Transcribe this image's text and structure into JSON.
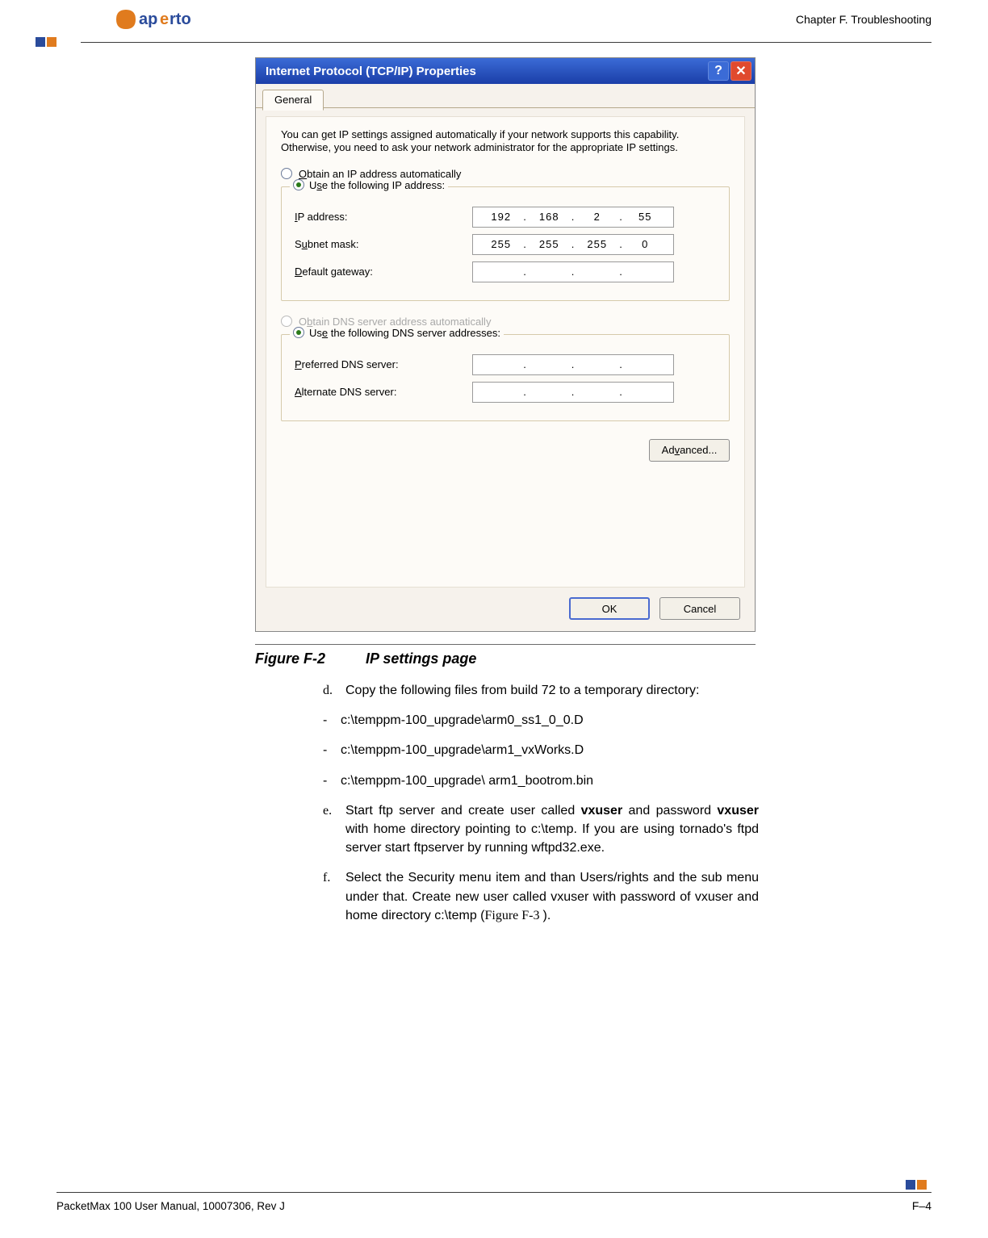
{
  "header": {
    "logo_a": "ap",
    "logo_b": "e",
    "logo_c": "rto",
    "chapter": "Chapter F.  Troubleshooting"
  },
  "dialog": {
    "title": "Internet Protocol (TCP/IP) Properties",
    "tab_general": "General",
    "intro": "You can get IP settings assigned automatically if your network supports this capability. Otherwise, you need to ask your network administrator for the appropriate IP settings.",
    "opt_obtain_ip": "Obtain an IP address automatically",
    "opt_use_ip": "Use the following IP address:",
    "lbl_ip": "IP address:",
    "lbl_subnet": "Subnet mask:",
    "lbl_gateway": "Default gateway:",
    "ip": {
      "a": "192",
      "b": "168",
      "c": "2",
      "d": "55"
    },
    "subnet": {
      "a": "255",
      "b": "255",
      "c": "255",
      "d": "0"
    },
    "gateway": {
      "a": "",
      "b": "",
      "c": "",
      "d": ""
    },
    "opt_obtain_dns": "Obtain DNS server address automatically",
    "opt_use_dns": "Use the following DNS server addresses:",
    "lbl_pref_dns": "Preferred DNS server:",
    "lbl_alt_dns": "Alternate DNS server:",
    "pref_dns": {
      "a": "",
      "b": "",
      "c": "",
      "d": ""
    },
    "alt_dns": {
      "a": "",
      "b": "",
      "c": "",
      "d": ""
    },
    "btn_advanced": "Advanced...",
    "btn_ok": "OK",
    "btn_cancel": "Cancel"
  },
  "caption": {
    "fignum": "Figure F-2",
    "title": "IP settings page"
  },
  "body": {
    "step_d_letter": "d.",
    "step_d": "Copy the following files from build 72 to a temporary directory:",
    "bullet1": "c:\\temppm-100_upgrade\\arm0_ss1_0_0.D",
    "bullet2": "c:\\temppm-100_upgrade\\arm1_vxWorks.D",
    "bullet3": "c:\\temppm-100_upgrade\\ arm1_bootrom.bin",
    "step_e_letter": "e.",
    "step_e_pre": "Start ftp server and create user called ",
    "step_e_b1": "vxuser",
    "step_e_mid": " and password ",
    "step_e_b2": "vxuser",
    "step_e_post": " with home directory pointing to c:\\temp. If you are using tornado's ftpd server start ftpserver by running wftpd32.exe.",
    "step_f_letter": "f.",
    "step_f_pre": "Select the Security menu item and than Users/rights and the sub menu under that. Create new user called vxuser with password of vxuser and home directory c:\\temp (",
    "step_f_figref": "Figure F-3 ",
    "step_f_post": ")."
  },
  "footer": {
    "left": "PacketMax 100 User Manual, 10007306, Rev J",
    "right": "F–4"
  }
}
